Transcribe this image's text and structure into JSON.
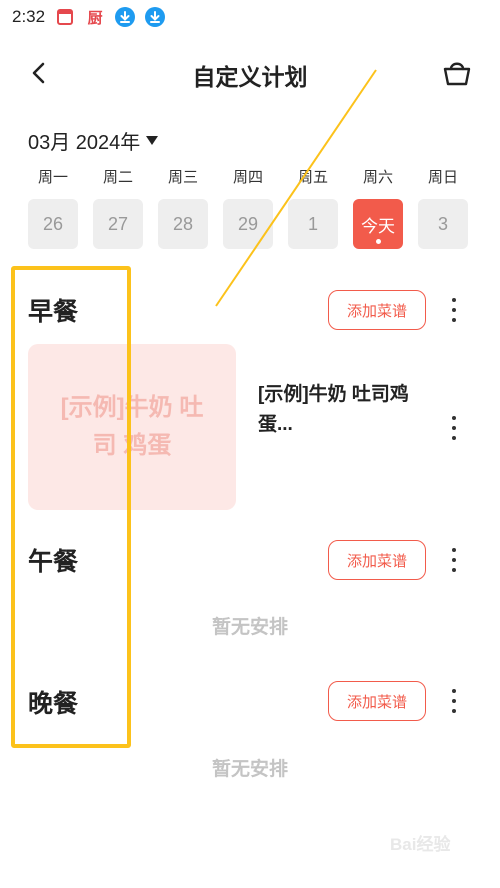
{
  "status_bar": {
    "time": "2:32",
    "chef_glyph": "厨",
    "icons": [
      "calendar-icon",
      "chef-icon",
      "download-icon",
      "download-icon"
    ]
  },
  "header": {
    "title": "自定义计划"
  },
  "month_selector": {
    "label": "03月 2024年"
  },
  "week": {
    "days": [
      {
        "weekday": "周一",
        "date": "26",
        "is_today": false
      },
      {
        "weekday": "周二",
        "date": "27",
        "is_today": false
      },
      {
        "weekday": "周三",
        "date": "28",
        "is_today": false
      },
      {
        "weekday": "周四",
        "date": "29",
        "is_today": false
      },
      {
        "weekday": "周五",
        "date": "1",
        "is_today": false
      },
      {
        "weekday": "周六",
        "date": "今天",
        "is_today": true
      },
      {
        "weekday": "周日",
        "date": "3",
        "is_today": false
      }
    ]
  },
  "meals": {
    "breakfast": {
      "title": "早餐",
      "add_label": "添加菜谱",
      "recipe": {
        "thumb_text": "[示例]牛奶 吐司 鸡蛋",
        "name": "[示例]牛奶 吐司鸡蛋..."
      }
    },
    "lunch": {
      "title": "午餐",
      "add_label": "添加菜谱",
      "empty_text": "暂无安排"
    },
    "dinner": {
      "title": "晚餐",
      "add_label": "添加菜谱",
      "empty_text": "暂无安排"
    }
  },
  "watermark": "Bai经验",
  "colors": {
    "accent": "#f25b4b",
    "highlight": "#fcc21b",
    "download_blue": "#1e9bf0"
  }
}
